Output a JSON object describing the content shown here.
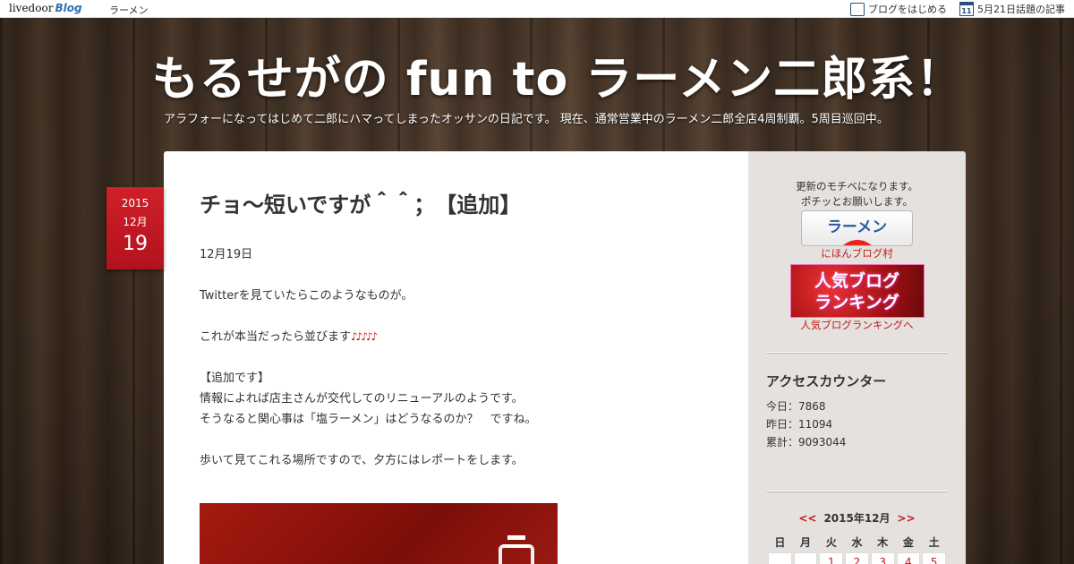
{
  "topbar": {
    "logo_main": "livedoor",
    "logo_blog": "Blog",
    "category": "ラーメン",
    "start_blog": "ブログをはじめる",
    "calendar_icon_day": "11",
    "trending": "5月21日話題の記事"
  },
  "header": {
    "title": "もるせがの fun to ラーメン二郎系！",
    "description": "アラフォーになってはじめて二郎にハマってしまったオッサンの日記です。 現在、通常営業中のラーメン二郎全店4周制覇。5周目巡回中。"
  },
  "post": {
    "date": {
      "year": "2015",
      "month": "12月",
      "day": "19"
    },
    "title": "チョ～短いですが＾＾；　【追加】",
    "lines": [
      "12月19日",
      "",
      "Twitterを見ていたらこのようなものが。",
      "",
      "これが本当だったら並びます",
      "",
      "【追加です】",
      "情報によれば店主さんが交代してのリニューアルのようです。",
      "そうなると関心事は「塩ラーメン」はどうなるのか？　ですね。",
      "",
      "歩いて見てこれる場所ですので、夕方にはレポートをします。"
    ],
    "notes": "♪♪♪♪♪"
  },
  "sidebar": {
    "motive_line1": "更新のモチベになります。",
    "motive_line2": "ポチッとお願いします。",
    "ramen_button": "ラーメン",
    "nihon_link": "にほんブログ村",
    "rank_banner_line1": "人気ブログ",
    "rank_banner_line2": "ランキング",
    "rank_link": "人気ブログランキングへ",
    "counter_title": "アクセスカウンター",
    "today": "今日：7868",
    "yesterday": "昨日：11094",
    "total": "累計：9093044",
    "calendar": {
      "prev": "<<",
      "month": "2015年12月",
      "next": ">>",
      "weekdays": [
        "日",
        "月",
        "火",
        "水",
        "木",
        "金",
        "土"
      ],
      "first_row": [
        "",
        "",
        "1",
        "2",
        "3",
        "4",
        "5"
      ]
    }
  },
  "colors": {
    "accent_red": "#c01a1a",
    "badge_red": "#d0202a",
    "link_blue": "#2b59a6"
  }
}
